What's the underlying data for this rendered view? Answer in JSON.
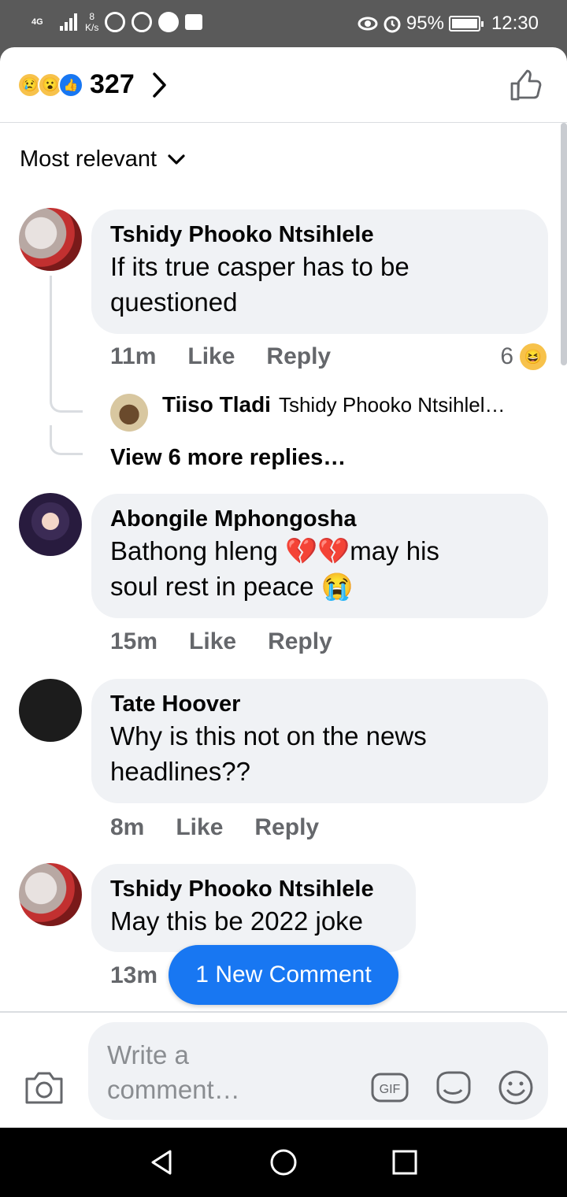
{
  "status_bar": {
    "network": "4G",
    "speed_value": "8",
    "speed_unit": "K/s",
    "battery": "95%",
    "time": "12:30"
  },
  "header": {
    "reaction_count": "327",
    "reactions": [
      "sad",
      "wow",
      "like"
    ]
  },
  "sort": {
    "label": "Most relevant"
  },
  "comments": [
    {
      "author": "Tshidy Phooko Ntsihlele",
      "text": "If its true casper has to be questioned",
      "time": "11m",
      "like": "Like",
      "reply": "Reply",
      "reaction_count": "6",
      "reply_preview": {
        "author": "Tiiso Tladi",
        "text": "Tshidy Phooko Ntsihlel…"
      },
      "more_replies": "View 6 more replies…"
    },
    {
      "author": "Abongile Mphongosha",
      "text_line1_a": "Bathong hleng ",
      "text_line1_emoji": "💔💔",
      "text_line1_b": "may his",
      "text_line2_a": "soul rest in peace ",
      "text_line2_emoji": "😭",
      "time": "15m",
      "like": "Like",
      "reply": "Reply"
    },
    {
      "author": "Tate Hoover",
      "text": "Why is this not on the news headlines??",
      "time": "8m",
      "like": "Like",
      "reply": "Reply"
    },
    {
      "author": "Tshidy Phooko Ntsihlele",
      "text": "May this be 2022 joke",
      "time": "13m"
    }
  ],
  "new_comment_banner": "1 New Comment",
  "composer": {
    "placeholder": "Write a comment…",
    "gif_label": "GIF"
  },
  "colors": {
    "accent": "#1877f2",
    "bubble": "#f0f2f5",
    "meta_text": "#65676b"
  }
}
